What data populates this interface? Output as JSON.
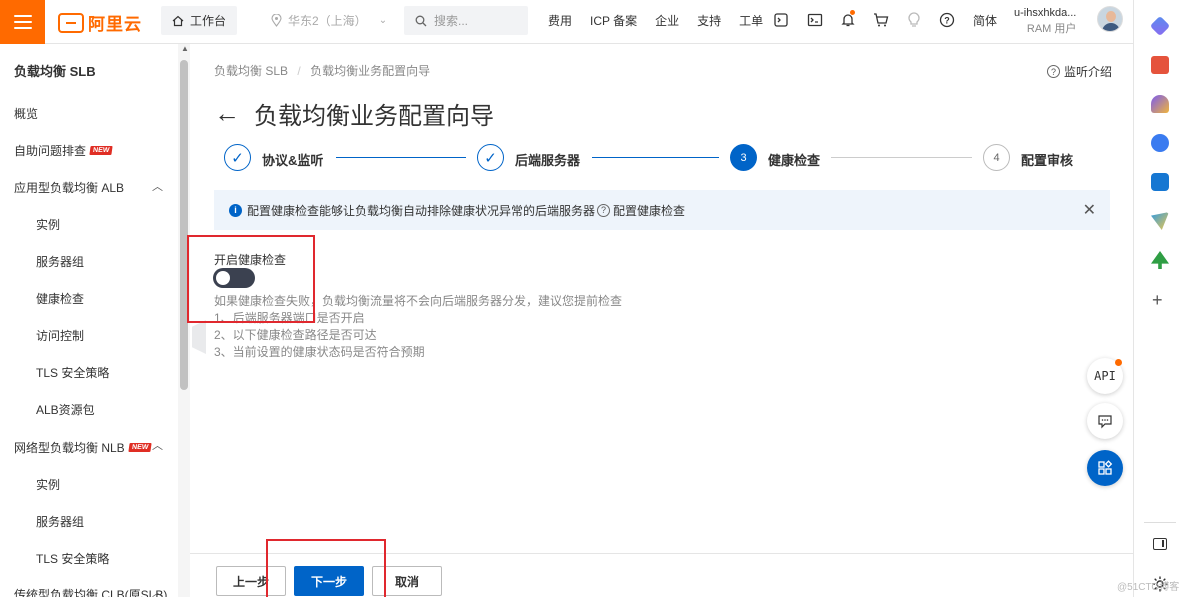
{
  "topbar": {
    "logo_text": "阿里云",
    "workbench": "工作台",
    "region": "华东2（上海）",
    "search_placeholder": "搜索...",
    "links": [
      "费用",
      "ICP 备案",
      "企业",
      "支持",
      "工单"
    ],
    "lang": "简体",
    "user_name": "u-ihsxhkda...",
    "user_role": "RAM 用户"
  },
  "sidebar": {
    "title": "负载均衡 SLB",
    "overview": "概览",
    "self_check": "自助问题排查",
    "new_badge": "NEW",
    "alb_group": "应用型负载均衡 ALB",
    "alb_items": [
      "实例",
      "服务器组",
      "健康检查",
      "访问控制",
      "TLS 安全策略",
      "ALB资源包"
    ],
    "nlb_group": "网络型负载均衡 NLB",
    "nlb_items": [
      "实例",
      "服务器组",
      "TLS 安全策略"
    ],
    "clb_group": "传统型负载均衡 CLB(原SLB)"
  },
  "main": {
    "breadcrumb": [
      "负载均衡 SLB",
      "负载均衡业务配置向导"
    ],
    "help_link": "监听介绍",
    "title": "负载均衡业务配置向导",
    "steps": [
      {
        "label": "协议&监听",
        "state": "done",
        "num": "✓"
      },
      {
        "label": "后端服务器",
        "state": "done",
        "num": "✓"
      },
      {
        "label": "健康检查",
        "state": "active",
        "num": "3"
      },
      {
        "label": "配置审核",
        "state": "todo",
        "num": "4"
      }
    ],
    "info_text": "配置健康检查能够让负载均衡自动排除健康状况异常的后端服务器",
    "info_help": "配置健康检查",
    "hc_label": "开启健康检查",
    "hc_enabled": "off",
    "hc_desc": [
      "如果健康检查失败，负载均衡流量将不会向后端服务器分发，建议您提前检查",
      "1、后端服务器端口是否开启",
      "2、以下健康检查路径是否可达",
      "3、当前设置的健康状态码是否符合预期"
    ]
  },
  "footer": {
    "prev": "上一步",
    "next": "下一步",
    "cancel": "取消"
  },
  "floating": {
    "api": "API",
    "colors": {
      "primary": "#0064c8",
      "brand": "#ff6a00",
      "highlight": "#e0282e"
    }
  },
  "watermark": "@51CTO博客"
}
